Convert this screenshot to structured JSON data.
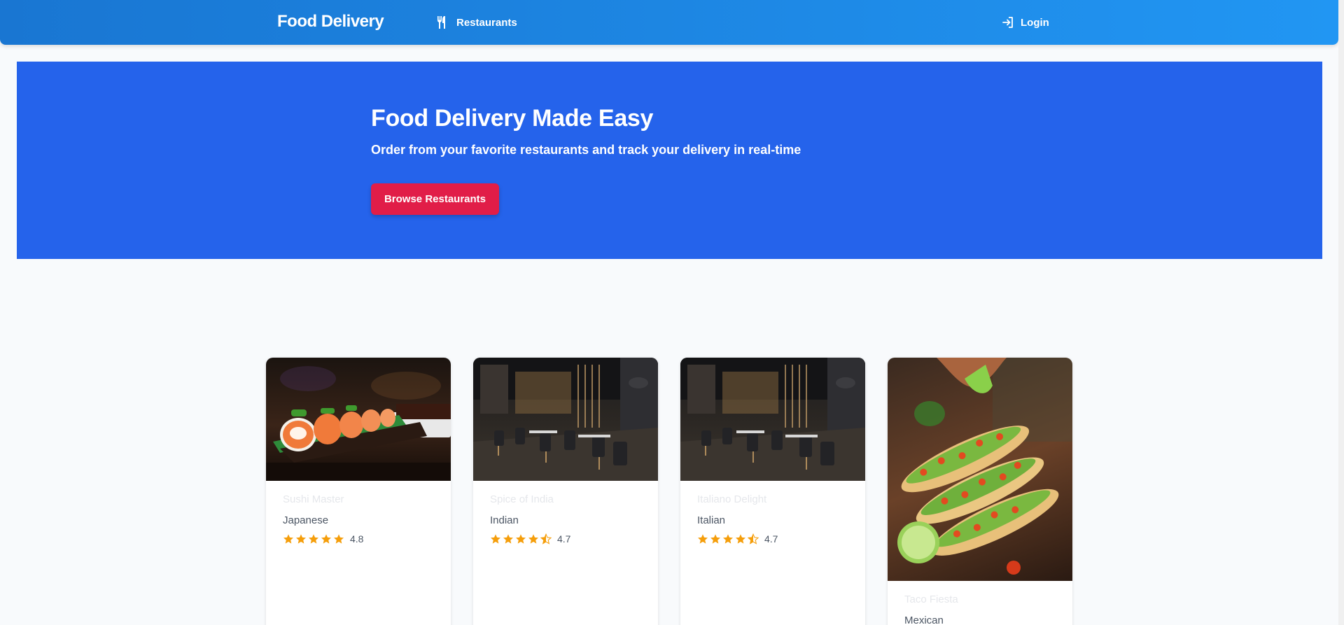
{
  "nav": {
    "brand": "Food Delivery",
    "restaurants_label": "Restaurants",
    "login_label": "Login"
  },
  "hero": {
    "title": "Food Delivery Made Easy",
    "subtitle": "Order from your favorite restaurants and track your delivery in real-time",
    "button_label": "Browse Restaurants"
  },
  "restaurants": [
    {
      "name": "Sushi Master",
      "cuisine": "Japanese",
      "rating": "4.8",
      "stars": 5,
      "image": "sushi-photo"
    },
    {
      "name": "Spice of India",
      "cuisine": "Indian",
      "rating": "4.7",
      "stars": 4.5,
      "image": "restaurant-interior-photo"
    },
    {
      "name": "Italiano Delight",
      "cuisine": "Italian",
      "rating": "4.7",
      "stars": 4.5,
      "image": "restaurant-interior-photo"
    },
    {
      "name": "Taco Fiesta",
      "cuisine": "Mexican",
      "rating": "",
      "stars": 0,
      "image": "tacos-photo"
    }
  ],
  "colors": {
    "navbar_start": "#1976d2",
    "navbar_end": "#2196f3",
    "hero": "#2563eb",
    "cta": "#e11d48",
    "star": "#f59e0b",
    "background": "#f8fafc"
  }
}
